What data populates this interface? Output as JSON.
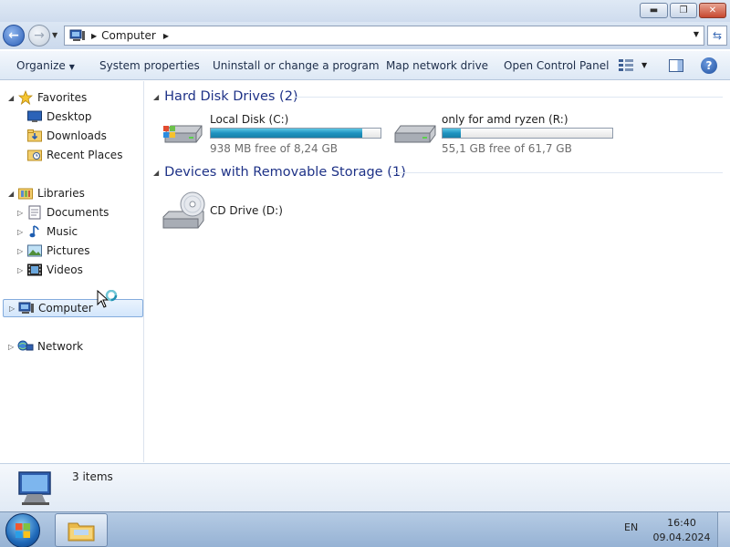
{
  "window": {
    "caption_buttons": {
      "minimize": "▬",
      "maximize": "❐",
      "close": "✕"
    }
  },
  "address_bar": {
    "path": [
      "Computer"
    ],
    "icon": "computer-icon"
  },
  "toolbar": {
    "organize": "Organize",
    "system_properties": "System properties",
    "uninstall": "Uninstall or change a program",
    "map_network": "Map network drive",
    "open_control_panel": "Open Control Panel"
  },
  "nav_pane": {
    "favorites": {
      "label": "Favorites",
      "items": [
        "Desktop",
        "Downloads",
        "Recent Places"
      ]
    },
    "libraries": {
      "label": "Libraries",
      "items": [
        "Documents",
        "Music",
        "Pictures",
        "Videos"
      ]
    },
    "computer": "Computer",
    "network": "Network"
  },
  "content": {
    "hard_disk_group": "Hard Disk Drives (2)",
    "removable_group": "Devices with Removable Storage (1)",
    "drives": [
      {
        "name": "Local Disk (C:)",
        "free": "938 MB free of 8,24 GB",
        "used_fraction": 0.89
      },
      {
        "name": "only for amd ryzen (R:)",
        "free": "55,1 GB free of 61,7 GB",
        "used_fraction": 0.107
      }
    ],
    "removable": [
      {
        "name": "CD Drive (D:)"
      }
    ]
  },
  "details": {
    "count": "3 items"
  },
  "taskbar": {
    "language": "EN",
    "time": "16:40",
    "date": "09.04.2024"
  },
  "colors": {
    "accent": "#1e3287",
    "bar_fill": "#1f93c0",
    "taskbar": "#a7c0de"
  }
}
